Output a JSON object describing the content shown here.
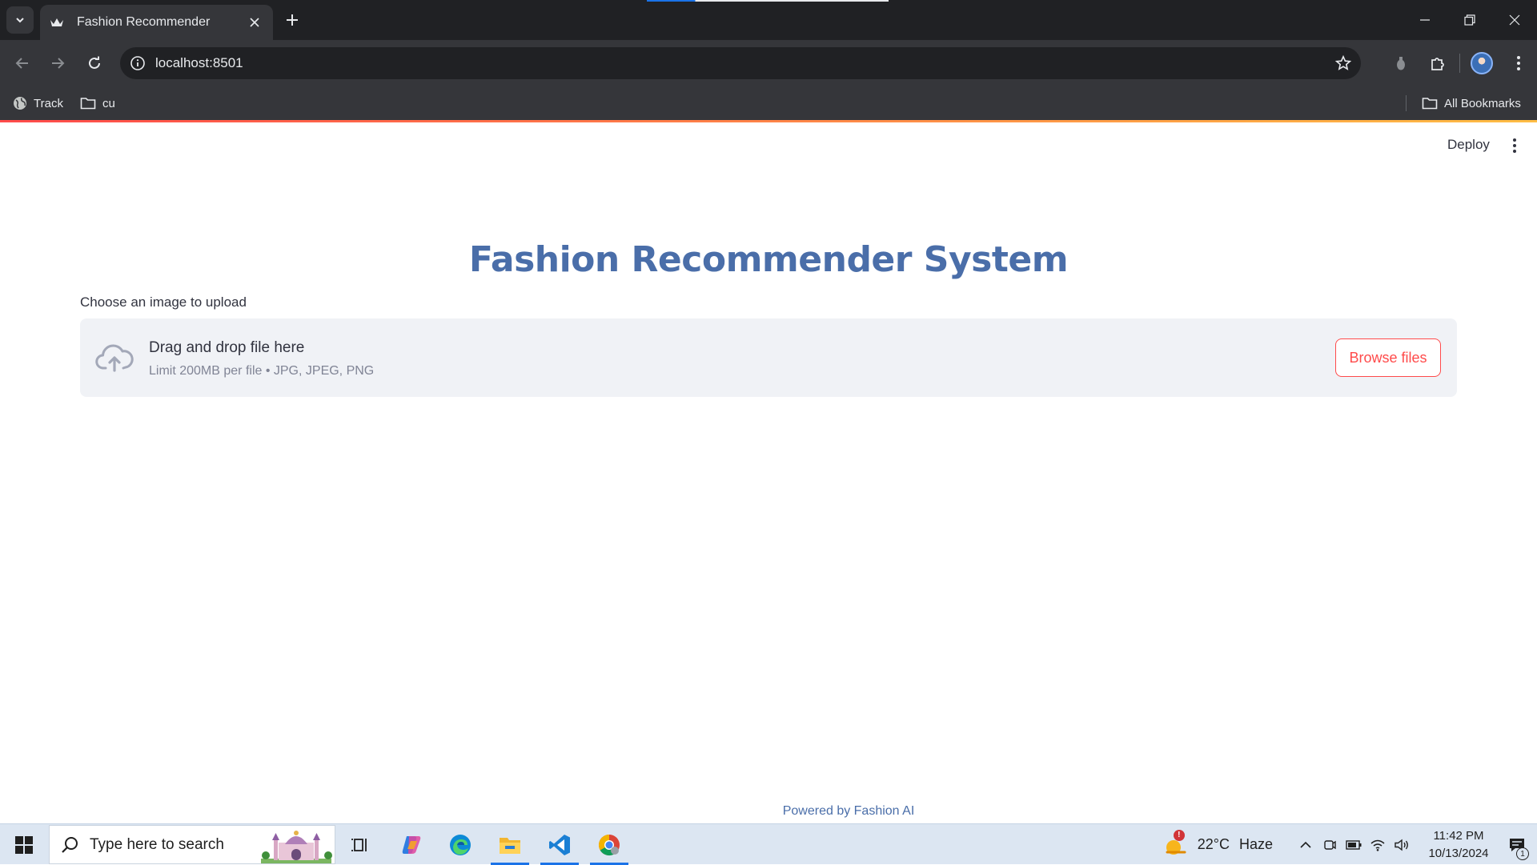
{
  "browser": {
    "tab_title": "Fashion Recommender",
    "url": "localhost:8501",
    "bookmarks": [
      {
        "label": "Track",
        "icon": "globe-icon"
      },
      {
        "label": "cu",
        "icon": "folder-icon"
      }
    ],
    "all_bookmarks_label": "All Bookmarks"
  },
  "app": {
    "deploy_label": "Deploy",
    "title": "Fashion Recommender System",
    "uploader": {
      "label": "Choose an image to upload",
      "drop_title": "Drag and drop file here",
      "drop_subtitle": "Limit 200MB per file • JPG, JPEG, PNG",
      "browse_label": "Browse files",
      "icon": "cloud-upload-icon"
    },
    "footer": "Powered by Fashion AI"
  },
  "taskbar": {
    "search_placeholder": "Type here to search",
    "apps": [
      "task-view-icon",
      "copilot-icon",
      "edge-icon",
      "file-explorer-icon",
      "vscode-icon",
      "chrome-icon"
    ],
    "weather": {
      "temperature": "22°C",
      "condition": "Haze",
      "alert_count": "!"
    },
    "time": "11:42 PM",
    "date": "10/13/2024",
    "notification_count": "1"
  },
  "colors": {
    "accent": "#ff4b4b",
    "title": "#4a6ea9",
    "dropzone_bg": "#f0f2f6",
    "chrome_dark": "#202124",
    "chrome_toolbar": "#35363a"
  }
}
